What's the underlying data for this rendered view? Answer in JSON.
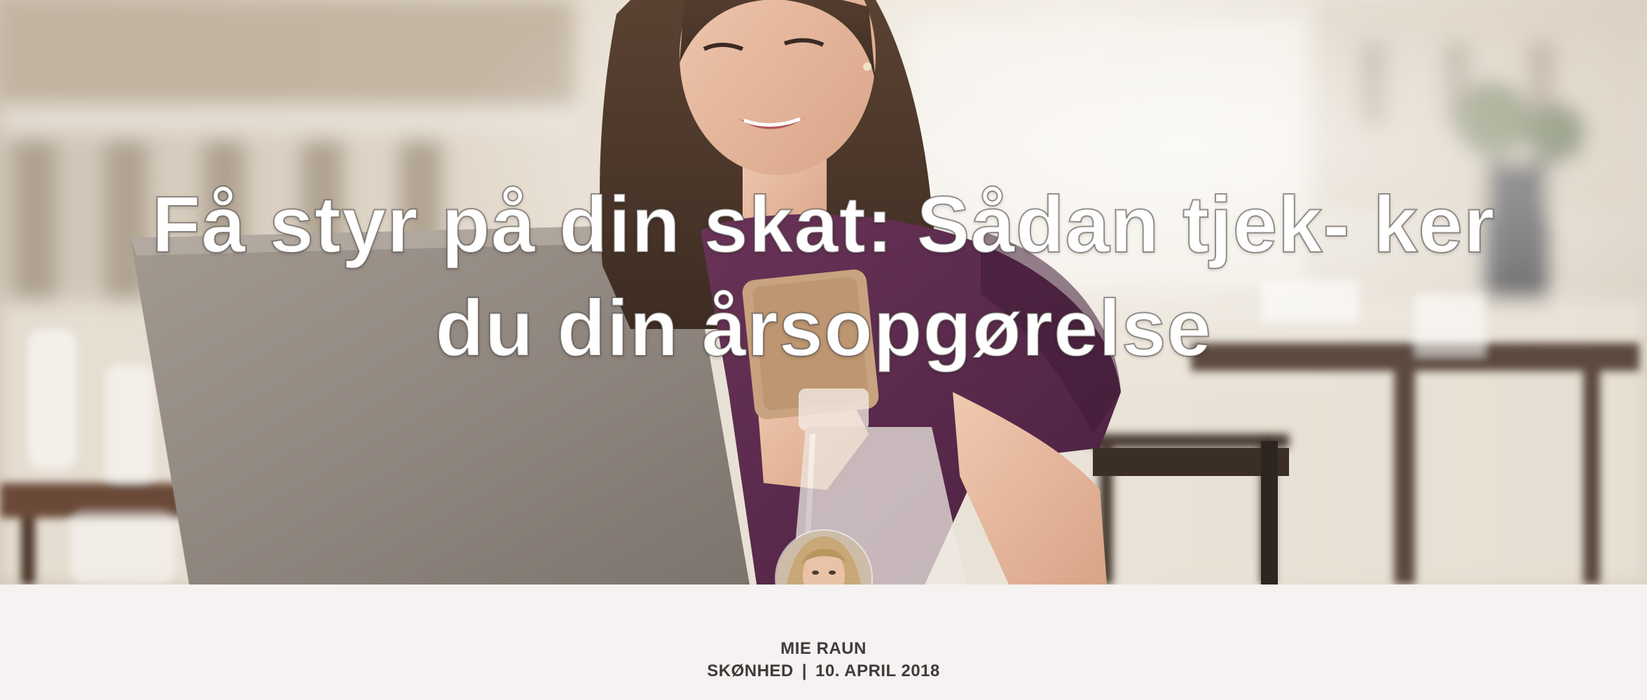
{
  "article": {
    "title": "Få styr på din skat: Sådan tjek- ker du din årsopgørelse",
    "author": "MIE RAUN",
    "category": "SKØNHED",
    "separator": "|",
    "date": "10. APRIL 2018"
  },
  "icons": {
    "avatar": "author-portrait",
    "hero": "woman-with-phone-and-laptop-photo"
  },
  "colors": {
    "meta_background": "#f5f2f1",
    "meta_text": "#3f3b3a",
    "title_text": "#ffffff",
    "blouse": "#5a2a4a"
  }
}
